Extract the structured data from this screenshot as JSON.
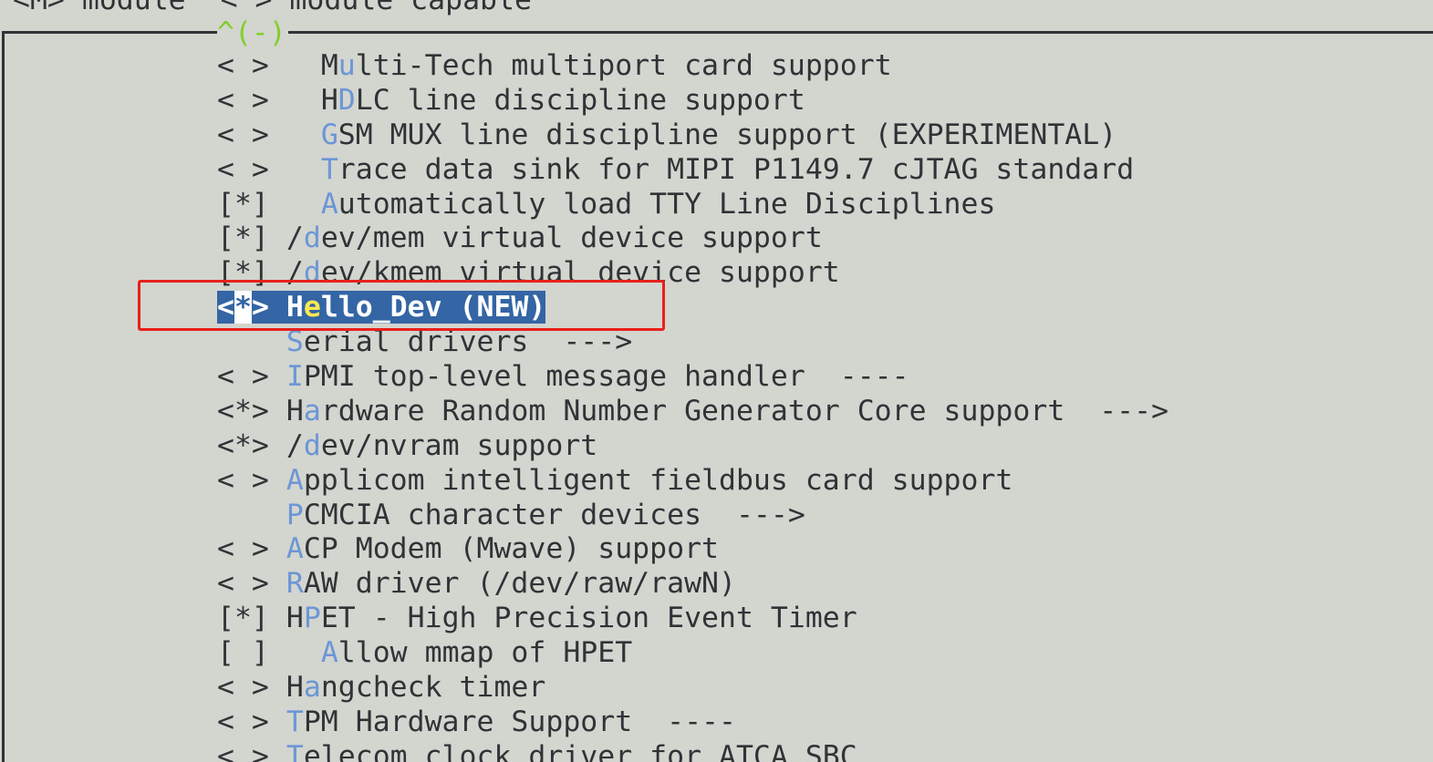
{
  "header": {
    "legend_text": "<M> module  < > module capable"
  },
  "scroll_indicator": "^(-)",
  "items": [
    {
      "prefix": "< >",
      "indent": "  ",
      "pre": "M",
      "hotkey": "u",
      "rest": "lti-Tech multiport card support"
    },
    {
      "prefix": "< >",
      "indent": "  ",
      "pre": "H",
      "hotkey": "D",
      "rest": "LC line discipline support"
    },
    {
      "prefix": "< >",
      "indent": "  ",
      "pre": "",
      "hotkey": "G",
      "rest": "SM MUX line discipline support (EXPERIMENTAL)"
    },
    {
      "prefix": "< >",
      "indent": "  ",
      "pre": "",
      "hotkey": "T",
      "rest": "race data sink for MIPI P1149.7 cJTAG standard"
    },
    {
      "prefix": "[*]",
      "indent": "  ",
      "pre": "",
      "hotkey": "A",
      "rest": "utomatically load TTY Line Disciplines"
    },
    {
      "prefix": "[*]",
      "indent": "",
      "pre": "/",
      "hotkey": "d",
      "rest": "ev/mem virtual device support"
    },
    {
      "prefix": "[*]",
      "indent": "",
      "pre": "/",
      "hotkey": "d",
      "rest": "ev/kmem virtual device support"
    },
    {
      "prefix": "<*>",
      "indent": "",
      "pre": "H",
      "hotkey": "e",
      "rest": "llo_Dev (NEW)",
      "selected": true
    },
    {
      "prefix": "   ",
      "indent": "",
      "pre": "",
      "hotkey": "S",
      "rest": "erial drivers  --->"
    },
    {
      "prefix": "< >",
      "indent": "",
      "pre": "",
      "hotkey": "I",
      "rest": "PMI top-level message handler  ----"
    },
    {
      "prefix": "<*>",
      "indent": "",
      "pre": "H",
      "hotkey": "a",
      "rest": "rdware Random Number Generator Core support  --->"
    },
    {
      "prefix": "<*>",
      "indent": "",
      "pre": "/",
      "hotkey": "d",
      "rest": "ev/nvram support"
    },
    {
      "prefix": "< >",
      "indent": "",
      "pre": "",
      "hotkey": "A",
      "rest": "pplicom intelligent fieldbus card support"
    },
    {
      "prefix": "   ",
      "indent": "",
      "pre": "",
      "hotkey": "P",
      "rest": "CMCIA character devices  --->"
    },
    {
      "prefix": "< >",
      "indent": "",
      "pre": "",
      "hotkey": "A",
      "rest": "CP Modem (Mwave) support"
    },
    {
      "prefix": "< >",
      "indent": "",
      "pre": "",
      "hotkey": "R",
      "rest": "AW driver (/dev/raw/rawN)"
    },
    {
      "prefix": "[*]",
      "indent": "",
      "pre": "H",
      "hotkey": "P",
      "rest": "ET - High Precision Event Timer"
    },
    {
      "prefix": "[ ]",
      "indent": "  ",
      "pre": "",
      "hotkey": "A",
      "rest": "llow mmap of HPET"
    },
    {
      "prefix": "< >",
      "indent": "",
      "pre": "H",
      "hotkey": "a",
      "rest": "ngcheck timer"
    },
    {
      "prefix": "< >",
      "indent": "",
      "pre": "",
      "hotkey": "T",
      "rest": "PM Hardware Support  ----"
    },
    {
      "prefix": "< >",
      "indent": "",
      "pre": "",
      "hotkey": "T",
      "rest": "elecom clock driver for ATCA SBC"
    }
  ],
  "colors": {
    "background": "#d3d5cf",
    "text": "#2e3436",
    "hotkey": "#6c96d6",
    "selection_bg": "#3465a4",
    "selection_hotkey": "#fce94f",
    "scroll_indicator": "#7fcf2b",
    "annotation_box": "#e8201c"
  }
}
